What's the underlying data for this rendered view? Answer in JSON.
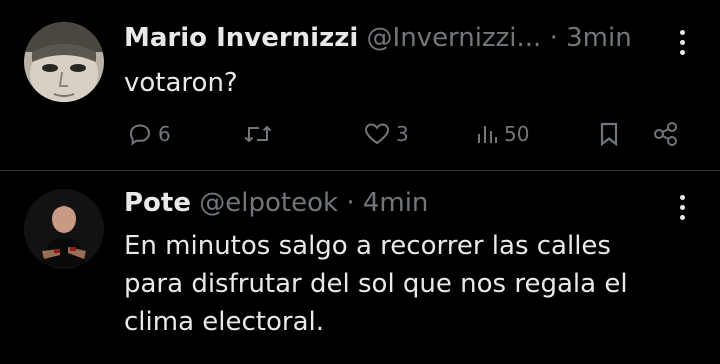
{
  "tweets": [
    {
      "name": "Mario Invernizzi",
      "handle": "@Invernizzi...",
      "separator": "·",
      "time": "3min",
      "text": "votaron?",
      "counts": {
        "replies": "6",
        "likes": "3",
        "views": "50"
      }
    },
    {
      "name": "Pote",
      "handle": "@elpoteok",
      "separator": "·",
      "time": "4min",
      "text_lines": [
        "En minutos salgo a recorrer las calles",
        "para disfrutar del sol que nos regala el",
        "clima electoral."
      ]
    }
  ],
  "icons": {
    "reply": "reply-icon",
    "retweet": "retweet-icon",
    "like": "heart-icon",
    "views": "views-chart-icon",
    "bookmark": "bookmark-icon",
    "share": "share-icon",
    "more": "more-vertical-icon"
  },
  "colors": {
    "background": "#000000",
    "text": "#e7e9ea",
    "muted": "#71767b",
    "divider": "#2f3336"
  }
}
